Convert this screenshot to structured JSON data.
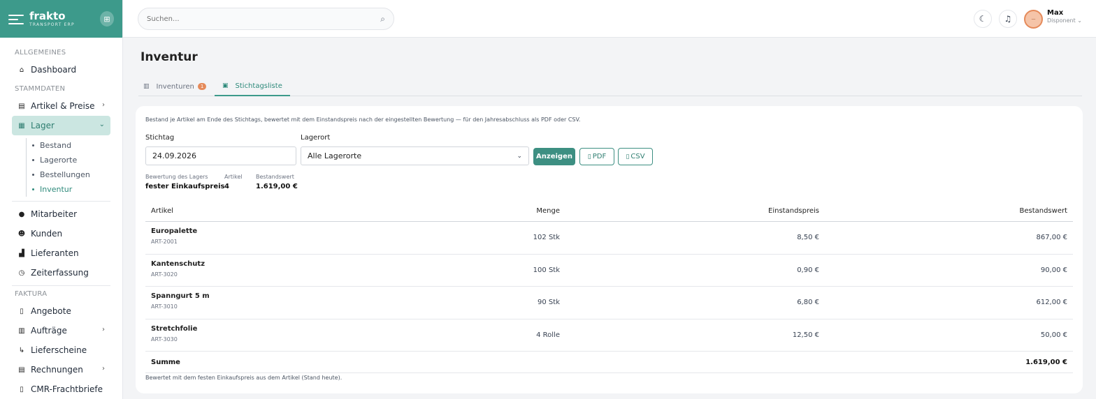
{
  "brand": {
    "name": "frakto",
    "subtitle": "TRANSPORT ERP"
  },
  "sidebar": {
    "sections": [
      {
        "label": "ALLGEMEINES"
      },
      {
        "label": "STAMMDATEN"
      },
      {
        "label": "FAKTURA"
      }
    ],
    "items": {
      "dashboard": "Dashboard",
      "artikel": "Artikel & Preise",
      "lager": "Lager",
      "mitarbeiter": "Mitarbeiter",
      "kunden": "Kunden",
      "lieferanten": "Lieferanten",
      "zeiterfassung": "Zeiterfassung",
      "angebote": "Angebote",
      "auftraege": "Aufträge",
      "lieferscheine": "Lieferscheine",
      "rechnungen": "Rechnungen",
      "cmr": "CMR-Frachtbriefe"
    },
    "lager_sub": [
      "Bestand",
      "Lagerorte",
      "Bestellungen",
      "Inventur"
    ]
  },
  "search": {
    "placeholder": "Suchen..."
  },
  "user": {
    "name": "Max",
    "role": "Disponent",
    "initials": "—"
  },
  "page": {
    "title": "Inventur"
  },
  "tabs": [
    {
      "label": "Inventuren",
      "badge": "1"
    },
    {
      "label": "Stichtagsliste"
    }
  ],
  "content": {
    "intro": "Bestand je Artikel am Ende des Stichtags, bewertet mit dem Einstandspreis nach der eingestellten Bewertung — für den Jahresabschluss als PDF oder CSV.",
    "stichtag_label": "Stichtag",
    "stichtag_value": "24.09.2026",
    "lagerort_label": "Lagerort",
    "lagerort_value": "Alle Lagerorte",
    "btn_anzeigen": "Anzeigen",
    "btn_pdf": "PDF",
    "btn_csv": "CSV",
    "stats": [
      {
        "label": "Bewertung des Lagers",
        "value": "fester Einkaufspreis"
      },
      {
        "label": "Artikel",
        "value": "4"
      },
      {
        "label": "Bestandswert",
        "value": "1.619,00 €"
      }
    ],
    "table": {
      "headers": [
        "Artikel",
        "Menge",
        "Einstandspreis",
        "Bestandswert"
      ],
      "rows": [
        {
          "name": "Europalette",
          "code": "ART-2001",
          "menge": "102 Stk",
          "preis": "8,50 €",
          "wert": "867,00 €"
        },
        {
          "name": "Kantenschutz",
          "code": "ART-3020",
          "menge": "100 Stk",
          "preis": "0,90 €",
          "wert": "90,00 €"
        },
        {
          "name": "Spanngurt 5 m",
          "code": "ART-3010",
          "menge": "90 Stk",
          "preis": "6,80 €",
          "wert": "612,00 €"
        },
        {
          "name": "Stretchfolie",
          "code": "ART-3030",
          "menge": "4 Rolle",
          "preis": "12,50 €",
          "wert": "50,00 €"
        }
      ],
      "sum_label": "Summe",
      "sum_value": "1.619,00 €"
    },
    "footnote": "Bewertet mit dem festen Einkaufspreis aus dem Artikel (Stand heute)."
  }
}
